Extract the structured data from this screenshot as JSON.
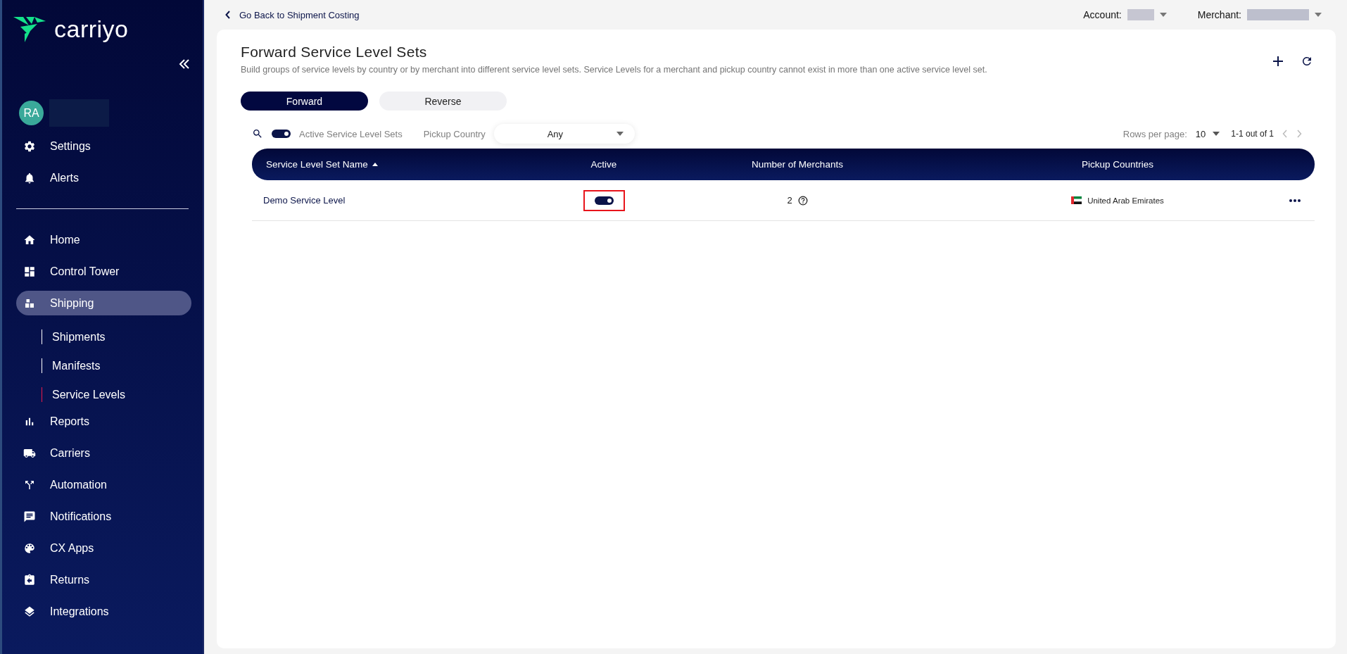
{
  "sidebar": {
    "logo": "carriyo",
    "user": {
      "initials": "RA"
    },
    "top_items": [
      {
        "label": "Settings",
        "selected": false
      },
      {
        "label": "Alerts",
        "selected": false
      }
    ],
    "nav_items": [
      {
        "label": "Home",
        "selected": false
      },
      {
        "label": "Control Tower",
        "selected": false
      },
      {
        "label": "Shipping",
        "selected": true,
        "expanded": true,
        "children": [
          {
            "label": "Shipments",
            "selected": false
          },
          {
            "label": "Manifests",
            "selected": false
          },
          {
            "label": "Service Levels",
            "selected": true
          }
        ]
      },
      {
        "label": "Reports",
        "selected": false
      },
      {
        "label": "Carriers",
        "selected": false
      },
      {
        "label": "Automation",
        "selected": false
      },
      {
        "label": "Notifications",
        "selected": false
      },
      {
        "label": "CX Apps",
        "selected": false
      },
      {
        "label": "Returns",
        "selected": false
      },
      {
        "label": "Integrations",
        "selected": false
      }
    ]
  },
  "top_bar": {
    "back_link": "Go Back to Shipment Costing",
    "account_label": "Account:",
    "merchant_label": "Merchant:"
  },
  "page": {
    "title": "Forward Service Level Sets",
    "description": "Build groups of service levels by country or by merchant into different service level sets. Service Levels for a merchant and pickup country cannot exist in more than one active service level set.",
    "tabs": [
      {
        "label": "Forward",
        "selected": true
      },
      {
        "label": "Reverse",
        "selected": false
      }
    ],
    "filters": {
      "active_only": {
        "label": "Active Service Level Sets",
        "on": true
      },
      "pickup_country": {
        "label": "Pickup Country",
        "value": "Any"
      }
    },
    "pagination": {
      "rows_per_page_label": "Rows per page:",
      "rows_per_page": "10",
      "range": "1-1 out of 1"
    },
    "table": {
      "columns": [
        {
          "label": "Service Level Set Name",
          "sorted": true
        },
        {
          "label": "Active",
          "sorted": false
        },
        {
          "label": "Number of Merchants",
          "sorted": false
        },
        {
          "label": "Pickup Countries",
          "sorted": false
        }
      ],
      "rows": [
        {
          "name": "Demo Service Level",
          "active": true,
          "highlighted": true,
          "merchants": "2",
          "pickup_country": "United Arab Emirates"
        }
      ]
    }
  }
}
